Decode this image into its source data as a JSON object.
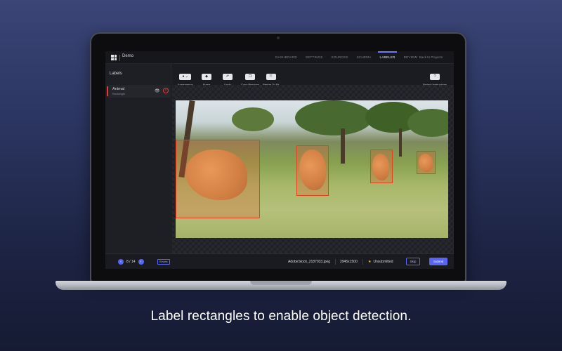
{
  "caption": "Label rectangles to enable object detection.",
  "app": {
    "project_name": "Demo",
    "nav_tabs": [
      "DASHBOARD",
      "SETTINGS",
      "SOURCES",
      "SCHEMA",
      "LABELER",
      "REVIEW"
    ],
    "active_tab": "LABELER",
    "back_link": "Back to Projects"
  },
  "left_panel": {
    "title": "Labels",
    "labels": [
      {
        "name": "Animal",
        "type": "Rectangle",
        "color": "#e53935"
      }
    ]
  },
  "toolbar": {
    "tools": [
      {
        "name": "appearance",
        "icon": "droplet-icon",
        "label": "Appearance"
      },
      {
        "name": "erase",
        "icon": "eraser-icon",
        "label": "Erase"
      },
      {
        "name": "undo",
        "icon": "undo-icon",
        "label": "Undo"
      },
      {
        "name": "copy-previous",
        "icon": "copy-icon",
        "label": "Copy Previous"
      },
      {
        "name": "resize-to-fit",
        "icon": "fit-icon",
        "label": "Resize To Fit"
      }
    ],
    "instructions": {
      "icon": "question-icon",
      "label": "Project Instructions"
    }
  },
  "annotations": [
    {
      "label": "Animal"
    },
    {
      "label": "Animal"
    },
    {
      "label": "Animal"
    },
    {
      "label": "Animal"
    }
  ],
  "bottom_bar": {
    "current_page": "8",
    "total_pages": "14",
    "page_text": "8 / 14",
    "review_tag": "Review",
    "file_name": "AdobeStock_2187033.jpeg",
    "dimensions": "2945x1500",
    "status": "Unsubmitted",
    "skip_label": "Skip",
    "submit_label": "Submit"
  },
  "colors": {
    "accent": "#5865f2",
    "label_red": "#e53935",
    "bbox": "#e8401f"
  }
}
